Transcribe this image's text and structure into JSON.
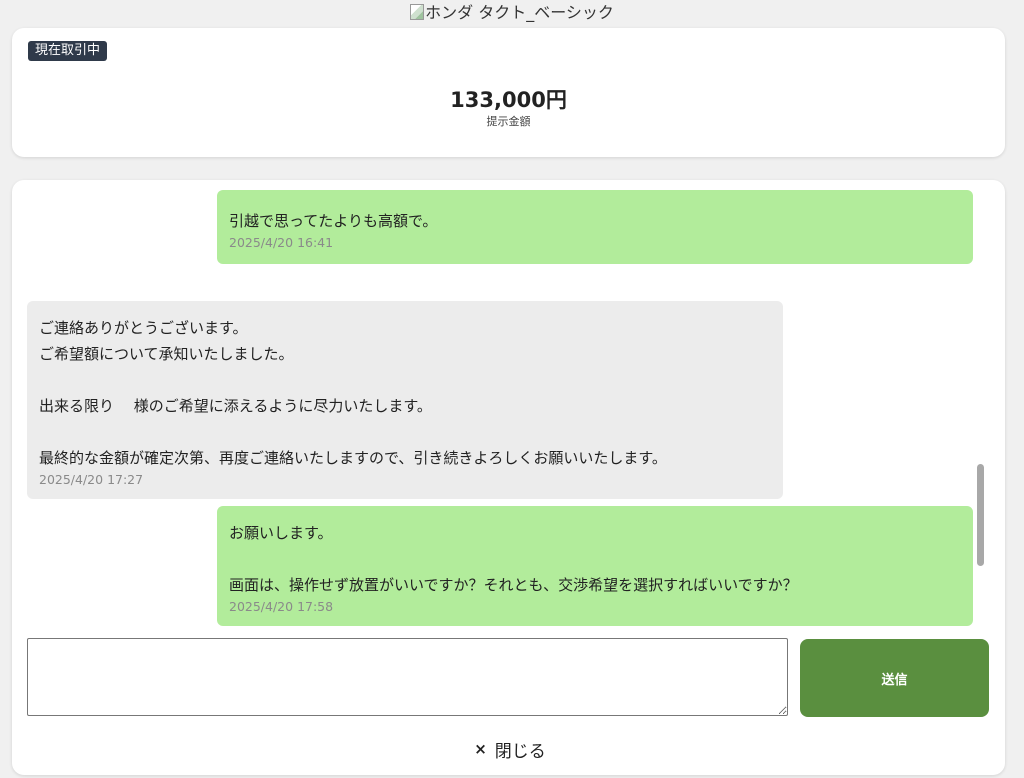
{
  "product": {
    "title": "ホンダ タクト_ベーシック",
    "image_status": "broken-image-icon"
  },
  "offer": {
    "status_badge": "現在取引中",
    "price": "133,000円",
    "price_label": "提示金額"
  },
  "messages": [
    {
      "sender": "me",
      "text": "引越で思ってたよりも高額で。",
      "time": "2025/4/20 16:41"
    },
    {
      "sender": "them",
      "text": "ご連絡ありがとうございます。\nご希望額について承知いたしました。\n\n出来る限り　 様のご希望に添えるように尽力いたします。\n\n最終的な金額が確定次第、再度ご連絡いたしますので、引き続きよろしくお願いいたします。",
      "time": "2025/4/20 17:27"
    },
    {
      "sender": "me",
      "text": "お願いします。\n\n画面は、操作せず放置がいいですか？それとも、交渉希望を選択すればいいですか？",
      "time": "2025/4/20 17:58"
    }
  ],
  "composer": {
    "value": "",
    "send_label": "送信"
  },
  "footer": {
    "close_label": "閉じる",
    "close_icon": "×"
  },
  "colors": {
    "my_bubble": "#b2ec9b",
    "their_bubble": "#ececec",
    "send_button": "#5a8f3f",
    "badge": "#2f3a4a"
  }
}
